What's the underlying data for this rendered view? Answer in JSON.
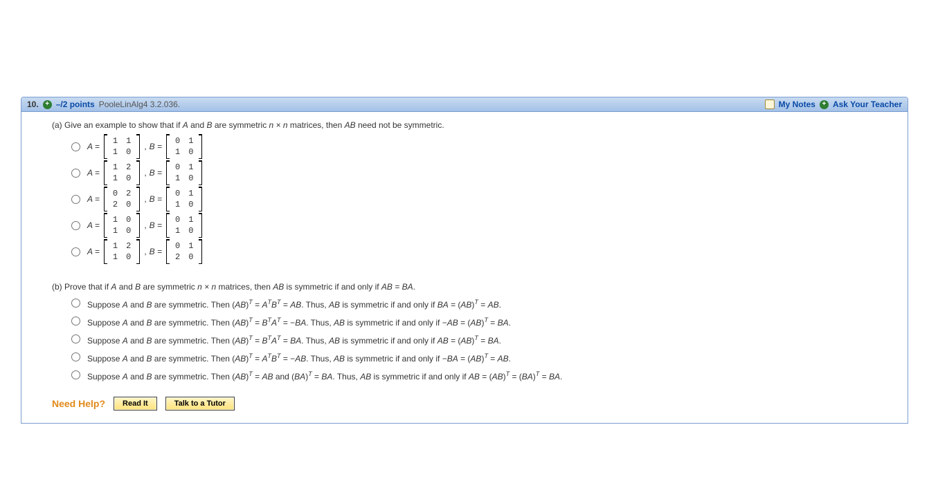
{
  "header": {
    "number": "10.",
    "points": "–/2 points",
    "source": "PooleLinAlg4 3.2.036.",
    "mynotes": "My Notes",
    "ask": "Ask Your Teacher"
  },
  "partA": {
    "label": "(a)",
    "prompt_pre": "Give an example to show that if ",
    "A": "A",
    "and": " and ",
    "B": "B",
    "mid": " are symmetric ",
    "nxn": "n × n",
    "post": " matrices, then ",
    "AB": "AB",
    "tail": " need not be symmetric.",
    "options": [
      {
        "A": [
          [
            "1",
            "1"
          ],
          [
            "1",
            "0"
          ]
        ],
        "B": [
          [
            "0",
            "1"
          ],
          [
            "1",
            "0"
          ]
        ]
      },
      {
        "A": [
          [
            "1",
            "2"
          ],
          [
            "1",
            "0"
          ]
        ],
        "B": [
          [
            "0",
            "1"
          ],
          [
            "1",
            "0"
          ]
        ]
      },
      {
        "A": [
          [
            "0",
            "2"
          ],
          [
            "2",
            "0"
          ]
        ],
        "B": [
          [
            "0",
            "1"
          ],
          [
            "1",
            "0"
          ]
        ]
      },
      {
        "A": [
          [
            "1",
            "0"
          ],
          [
            "1",
            "0"
          ]
        ],
        "B": [
          [
            "0",
            "1"
          ],
          [
            "1",
            "0"
          ]
        ]
      },
      {
        "A": [
          [
            "1",
            "2"
          ],
          [
            "1",
            "0"
          ]
        ],
        "B": [
          [
            "0",
            "1"
          ],
          [
            "2",
            "0"
          ]
        ]
      }
    ],
    "Aeq": "A = ",
    "comma": ", ",
    "Beq": "B = "
  },
  "partB": {
    "label": "(b)",
    "prompt_pre": "Prove that if ",
    "A": "A",
    "and": " and ",
    "B": "B",
    "mid": " are symmetric ",
    "nxn": "n × n",
    "post": " matrices, then ",
    "AB": "AB",
    "iff": " is symmetric if and only if ",
    "ABeqBA": "AB = BA",
    "period": ".",
    "options": [
      {
        "lead": "Suppose ",
        "A": "A",
        "and": " and ",
        "B": "B",
        "sym": " are symmetric. Then (",
        "AB1": "AB",
        "rp": ")",
        "eq1": " = ",
        "lhs": "A",
        "sup1": "T",
        "rhs": "B",
        "sup2": "T",
        "eq2": " = ",
        "res": "AB",
        "tail1": ". Thus, ",
        "AB2": "AB",
        "tail2": " is symmetric if and only if ",
        "cond1": "BA",
        "eq3": " = (",
        "AB3": "AB",
        "rp2": ")",
        "eq4": " = ",
        "cond2": "AB",
        "end": "."
      },
      {
        "lead": "Suppose ",
        "A": "A",
        "and": " and ",
        "B": "B",
        "sym": " are symmetric. Then (",
        "AB1": "AB",
        "rp": ")",
        "eq1": " = ",
        "lhs": "B",
        "sup1": "T",
        "rhs": "A",
        "sup2": "T",
        "eq2": " = −",
        "res": "BA",
        "tail1": ". Thus, ",
        "AB2": "AB",
        "tail2": " is symmetric if and only if −",
        "cond1": "AB",
        "eq3": " = (",
        "AB3": "AB",
        "rp2": ")",
        "eq4": " = ",
        "cond2": "BA",
        "end": "."
      },
      {
        "lead": "Suppose ",
        "A": "A",
        "and": " and ",
        "B": "B",
        "sym": " are symmetric. Then (",
        "AB1": "AB",
        "rp": ")",
        "eq1": " = ",
        "lhs": "B",
        "sup1": "T",
        "rhs": "A",
        "sup2": "T",
        "eq2": " = ",
        "res": "BA",
        "tail1": ". Thus, ",
        "AB2": "AB",
        "tail2": " is symmetric if and only if ",
        "cond1": "AB",
        "eq3": " = (",
        "AB3": "AB",
        "rp2": ")",
        "eq4": " = ",
        "cond2": "BA",
        "end": "."
      },
      {
        "lead": "Suppose ",
        "A": "A",
        "and": " and ",
        "B": "B",
        "sym": " are symmetric. Then (",
        "AB1": "AB",
        "rp": ")",
        "eq1": " = ",
        "lhs": "A",
        "sup1": "T",
        "rhs": "B",
        "sup2": "T",
        "eq2": " = −",
        "res": "AB",
        "tail1": ". Thus, ",
        "AB2": "AB",
        "tail2": " is symmetric if and only if −",
        "cond1": "BA",
        "eq3": " = (",
        "AB3": "AB",
        "rp2": ")",
        "eq4": " = ",
        "cond2": "AB",
        "end": "."
      },
      {
        "lead": "Suppose ",
        "A": "A",
        "and": " and ",
        "B": "B",
        "sym": " are symmetric. Then (",
        "AB1": "AB",
        "rp": ")",
        "eq1": " = ",
        "res1": "AB",
        "mid": " and (",
        "BA1": "BA",
        "rp2": ")",
        "eq2": " = ",
        "res2": "BA",
        "tail1": ". Thus, ",
        "AB2": "AB",
        "tail2": " is symmetric if and only if ",
        "cond1": "AB",
        "eq3": " = (",
        "AB3": "AB",
        "rp3": ")",
        "eq4": " = (",
        "BA2": "BA",
        "rp4": ")",
        "eq5": " = ",
        "cond2": "BA",
        "end": "."
      }
    ]
  },
  "help": {
    "label": "Need Help?",
    "read": "Read It",
    "tutor": "Talk to a Tutor"
  }
}
